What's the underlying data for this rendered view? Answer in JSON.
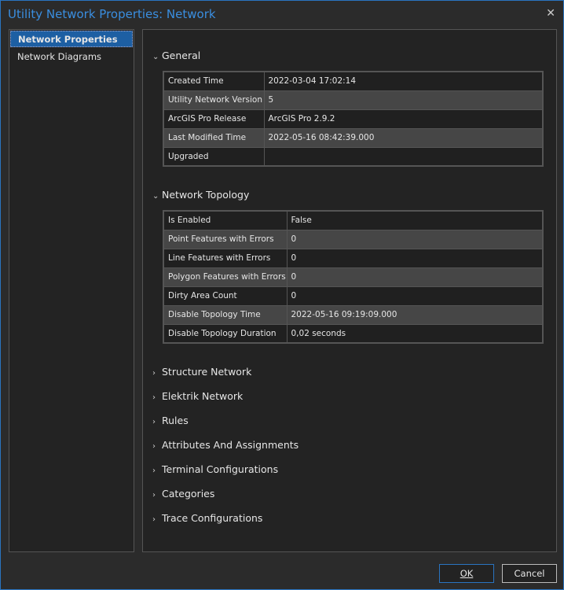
{
  "window": {
    "title": "Utility Network Properties: Network",
    "close": "✕"
  },
  "sidebar": {
    "items": [
      {
        "label": "Network Properties",
        "selected": true
      },
      {
        "label": "Network Diagrams"
      }
    ]
  },
  "general": {
    "title": "General",
    "rows": [
      [
        "Created Time",
        "2022-03-04 17:02:14"
      ],
      [
        "Utility Network Version",
        "5"
      ],
      [
        "ArcGIS Pro Release",
        "ArcGIS Pro 2.9.2"
      ],
      [
        "Last Modified Time",
        "2022-05-16 08:42:39.000"
      ],
      [
        "Upgraded",
        ""
      ]
    ]
  },
  "topology": {
    "title": "Network Topology",
    "rows": [
      [
        "Is Enabled",
        "False"
      ],
      [
        "Point Features with Errors",
        "0"
      ],
      [
        "Line Features with Errors",
        "0"
      ],
      [
        "Polygon Features with Errors",
        "0"
      ],
      [
        "Dirty Area Count",
        "0"
      ],
      [
        "Disable Topology Time",
        "2022-05-16 09:19:09.000"
      ],
      [
        "Disable Topology Duration",
        "0,02 seconds"
      ]
    ]
  },
  "collapsed": [
    "Structure Network",
    "Elektrik Network",
    "Rules",
    "Attributes And Assignments",
    "Terminal Configurations",
    "Categories",
    "Trace Configurations"
  ],
  "buttons": {
    "ok": "OK",
    "cancel": "Cancel"
  }
}
